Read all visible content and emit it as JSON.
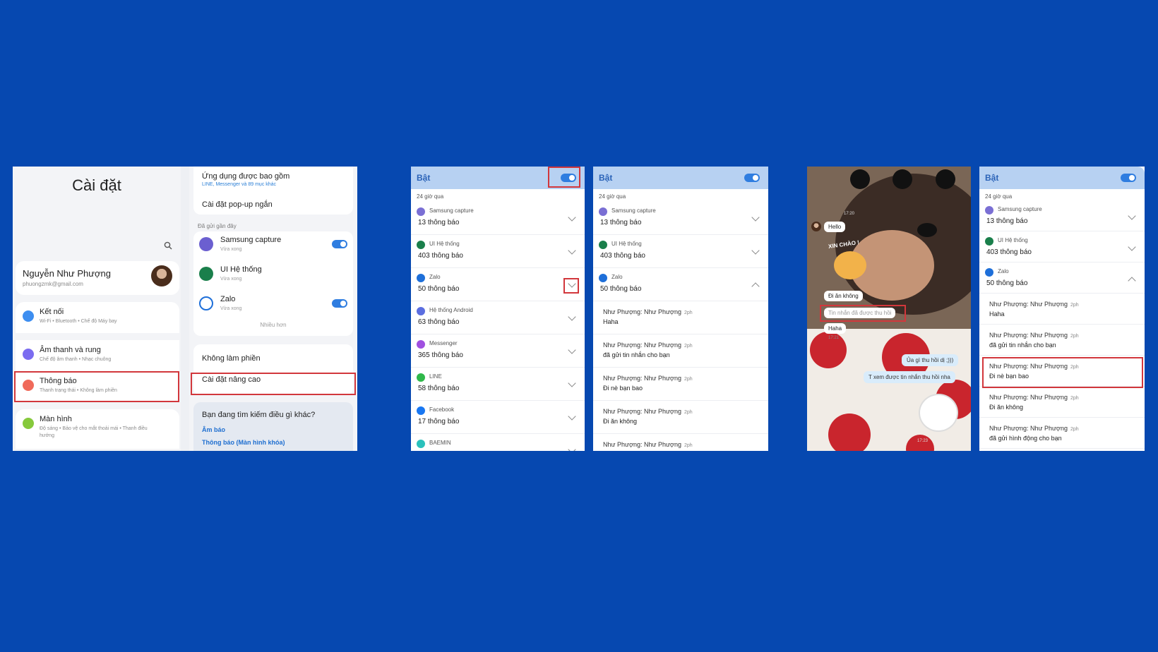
{
  "panel1": {
    "settings_title": "Cài đặt",
    "profile": {
      "name": "Nguyễn Như Phượng",
      "email": "phuongzmk@gmail.com"
    },
    "settings_items": [
      {
        "label": "Kết nối",
        "sub": "Wi-Fi • Bluetooth • Chế độ Máy bay",
        "icon": "wifi-icon",
        "color": "#3d8ef0"
      },
      {
        "label": "Âm thanh và rung",
        "sub": "Chế độ âm thanh • Nhạc chuông",
        "icon": "speaker-icon",
        "color": "#7b6cf0"
      },
      {
        "label": "Thông báo",
        "sub": "Thanh trạng thái • Không làm phiền",
        "icon": "notification-icon",
        "color": "#f06a5a"
      },
      {
        "label": "Màn hình",
        "sub": "Độ sáng • Bảo vệ cho mắt thoải mái • Thanh điều",
        "sub2": "hướng",
        "icon": "display-icon",
        "color": "#86c93c"
      }
    ],
    "right": {
      "included_title": "Ứng dụng được bao gồm",
      "included_sub": "LINE, Messenger và 89 mục khác",
      "popup_label": "Cài đặt pop-up ngắn",
      "recent_section": "Đã gửi gần đây",
      "recent_apps": [
        {
          "name": "Samsung capture",
          "sub": "Vừa xong",
          "color": "#6b5fd0"
        },
        {
          "name": "UI Hệ thống",
          "sub": "Vừa xong",
          "color": "#1a7f4b"
        },
        {
          "name": "Zalo",
          "sub": "Vừa xong",
          "color": "#1e6fd9"
        }
      ],
      "more_label": "Nhiều hơn",
      "dnd_label": "Không làm phiền",
      "advanced_label": "Cài đặt nâng cao",
      "search_question": "Bạn đang tìm kiếm điều gì khác?",
      "link1": "Âm báo",
      "link2": "Thông báo (Màn hình khóa)"
    }
  },
  "panel2": {
    "header": "Bật",
    "section": "24 giờ qua",
    "left_rows": [
      {
        "app": "Samsung capture",
        "count": "13 thông báo",
        "color": "#7a6fd4"
      },
      {
        "app": "UI Hệ thống",
        "count": "403 thông báo",
        "color": "#1a7f4b"
      },
      {
        "app": "Zalo",
        "count": "50 thông báo",
        "color": "#1e6fd9"
      },
      {
        "app": "Hệ thống Android",
        "count": "63 thông báo",
        "color": "#5b6ee0"
      },
      {
        "app": "Messenger",
        "count": "365 thông báo",
        "color": "#a050e0"
      },
      {
        "app": "LINE",
        "count": "58 thông báo",
        "color": "#2fb84a"
      },
      {
        "app": "Facebook",
        "count": "17 thông báo",
        "color": "#1877f2"
      },
      {
        "app": "BAEMIN",
        "count": "",
        "color": "#2ac1bc"
      }
    ],
    "right_rows": [
      {
        "app": "Samsung capture",
        "count": "13 thông báo",
        "color": "#7a6fd4"
      },
      {
        "app": "UI Hệ thống",
        "count": "403 thông báo",
        "color": "#1a7f4b"
      },
      {
        "app": "Zalo",
        "count": "50 thông báo",
        "color": "#1e6fd9"
      }
    ],
    "messages": [
      {
        "title": "Như Phượng: Như Phượng",
        "time": "2ph",
        "body": "Haha"
      },
      {
        "title": "Như Phượng: Như Phượng",
        "time": "2ph",
        "body": "đã gửi tin nhắn cho bạn"
      },
      {
        "title": "Như Phượng: Như Phượng",
        "time": "2ph",
        "body": "Đi nè bạn bao"
      },
      {
        "title": "Như Phượng: Như Phượng",
        "time": "2ph",
        "body": "Đi ăn không"
      },
      {
        "title": "Như Phượng: Như Phượng",
        "time": "2ph",
        "body": ""
      }
    ]
  },
  "panel3": {
    "chat": {
      "time_top": "17:20",
      "hello": "Hello",
      "sticker_text": "XIN CHÀO !",
      "di_an": "Đi ăn không",
      "recalled": "Tin nhắn đã được thu hồi",
      "haha": "Haha",
      "haha_time": "17:21",
      "ua_gi": "Ủa gì thu hồi dị ;)))",
      "t_xem": "T xem được tin nhắn thu hồi nha",
      "time_bottom": "17:23"
    },
    "header": "Bật",
    "section": "24 giờ qua",
    "rows": [
      {
        "app": "Samsung capture",
        "count": "13 thông báo",
        "color": "#7a6fd4"
      },
      {
        "app": "UI Hệ thống",
        "count": "403 thông báo",
        "color": "#1a7f4b"
      },
      {
        "app": "Zalo",
        "count": "50 thông báo",
        "color": "#1e6fd9"
      }
    ],
    "messages": [
      {
        "title": "Như Phượng: Như Phượng",
        "time": "2ph",
        "body": "Haha"
      },
      {
        "title": "Như Phượng: Như Phượng",
        "time": "2ph",
        "body": "đã gửi tin nhắn cho bạn"
      },
      {
        "title": "Như Phượng: Như Phượng",
        "time": "2ph",
        "body": "Đi nè bạn bao"
      },
      {
        "title": "Như Phượng: Như Phượng",
        "time": "2ph",
        "body": "Đi ăn không"
      },
      {
        "title": "Như Phượng: Như Phượng",
        "time": "2ph",
        "body": "đã gửi hình động cho bạn"
      }
    ]
  }
}
